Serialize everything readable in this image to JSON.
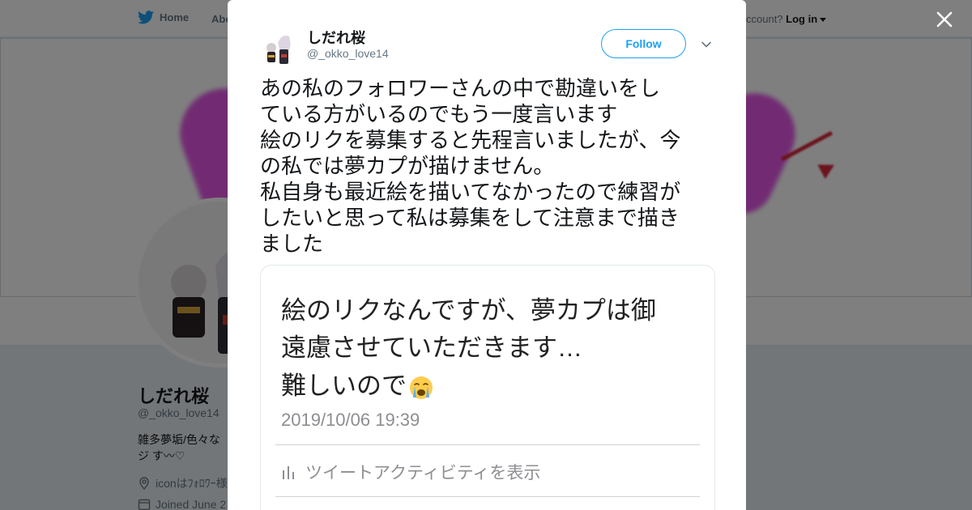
{
  "nav": {
    "home": "Home",
    "about": "Abo",
    "account_prompt": "ccount?",
    "login": "Log in"
  },
  "profile": {
    "name": "しだれ桜",
    "handle": "@_okko_love14",
    "bio": "雑多夢垢/色々なジ す〰♡",
    "location": "iconはﾌｫﾛﾜｰ様",
    "joined": "Joined June 2"
  },
  "tweet": {
    "author_name": "しだれ桜",
    "author_handle": "@_okko_love14",
    "follow_label": "Follow",
    "lines": [
      "あの私のフォロワーさんの中で勘違いをし",
      "ている方がいるのでもう一度言います",
      "絵のリクを募集すると先程言いましたが、今",
      "の私では夢カプが描けません。",
      "私自身も最近絵を描いてなかったので練習が",
      "したいと思って私は募集をして注意まで描き",
      "ました"
    ]
  },
  "screenshot": {
    "line1": "絵のリクなんですが、夢カプは御",
    "line2": "遠慮させていただきます…",
    "line3": "難しいので",
    "timestamp": "2019/10/06 19:39",
    "activity": "ツイートアクティビティを表示"
  },
  "colors": {
    "accent": "#1da1f2",
    "text": "#14171a",
    "muted": "#657786"
  },
  "icons": {
    "close": "close-icon",
    "more": "chevron-down-icon",
    "bird": "twitter-bird-icon"
  }
}
